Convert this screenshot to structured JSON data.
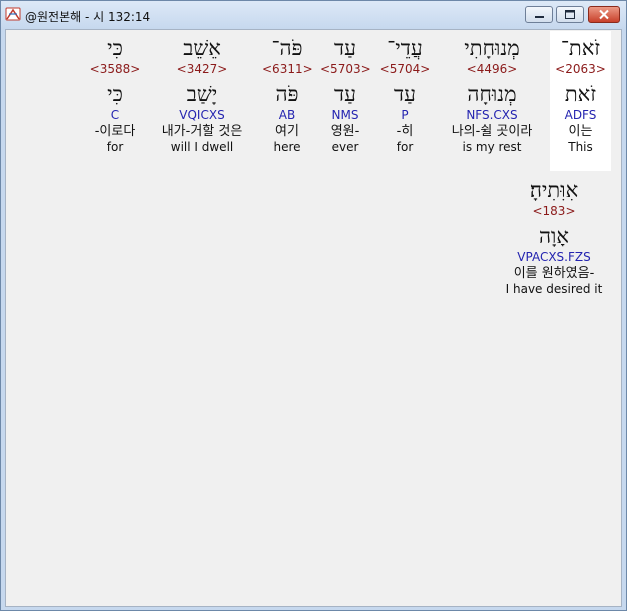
{
  "window": {
    "title": "@원전본해 - 시 132:14",
    "icon": "bible-app-icon"
  },
  "colors": {
    "strong_number": "#8b1a1a",
    "parsing_code": "#2424b0",
    "selected_bg": "#ffffff"
  },
  "words": [
    {
      "hebrew": "זֹאת־",
      "strong": "<2063>",
      "lemma": "זֹאת",
      "parsing": "ADFS",
      "korean": "이는",
      "english": "This",
      "selected": true
    },
    {
      "hebrew": "מְנוּחָתִי",
      "strong": "<4496>",
      "lemma": "מְנוּחָה",
      "parsing": "NFS.CXS",
      "korean": "나의-쉴 곳이라",
      "english": "is my rest",
      "selected": false
    },
    {
      "hebrew": "עֲדֵי־",
      "strong": "<5704>",
      "lemma": "עַד",
      "parsing": "P",
      "korean": "-히",
      "english": "for",
      "selected": false
    },
    {
      "hebrew": "עַד",
      "strong": "<5703>",
      "lemma": "עַד",
      "parsing": "NMS",
      "korean": "영원-",
      "english": "ever",
      "selected": false
    },
    {
      "hebrew": "פֹּה־",
      "strong": "<6311>",
      "lemma": "פֹּה",
      "parsing": "AB",
      "korean": "여기",
      "english": "here",
      "selected": false
    },
    {
      "hebrew": "אֵשֵׁב",
      "strong": "<3427>",
      "lemma": "יָשַׁב",
      "parsing": "VQICXS",
      "korean": "내가-거할 것은",
      "english": "will I dwell",
      "selected": false
    },
    {
      "hebrew": "כִּי",
      "strong": "<3588>",
      "lemma": "כִּי",
      "parsing": "C",
      "korean": "-이로다",
      "english": "for",
      "selected": false
    },
    {
      "hebrew": "אִוִּתִיהָ׃",
      "strong": "<183>",
      "lemma": "אָוָה",
      "parsing": "VPACXS.FZS",
      "korean": "이를 원하였음-",
      "english": "I have desired it",
      "selected": false
    }
  ]
}
